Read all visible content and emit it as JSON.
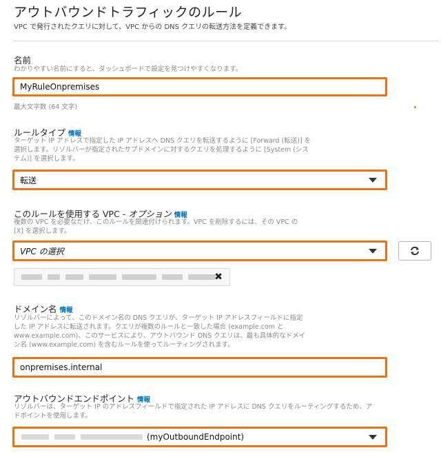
{
  "header": {
    "title": "アウトバウンドトラフィックのルール",
    "subtitle": "VPC で発行されたクエリに対して、VPC からの DNS クエリの転送方法を定義できます。"
  },
  "name_section": {
    "label": "名前",
    "help": "わかりやすい名前にすると、ダッシュボードで設定を見つけやすくなります。",
    "value": "MyRuleOnpremises",
    "limit": "最大文字数 (64 文字)"
  },
  "rule_type": {
    "label": "ルールタイプ",
    "info": "情報",
    "help_line1": "ターゲット IP アドレスで指定した IP アドレスへ DNS クエリを転送するように [Forward (転送)] を",
    "help_line2": "選択します。リゾルバーが指定されたサブドメインに対するクエリを処理するように [System (シス",
    "help_line3": "テム)] を選択します。",
    "value": "転送"
  },
  "vpc_section": {
    "label": "このルールを使用する VPC - ",
    "label_optional": "オプション",
    "info": "情報",
    "help_line1": "複数の VPC を必要なだけ、このルールを関連付けられます。VPC を削除するには、その VPC の",
    "help_line2": "[X] を選択します。",
    "placeholder": "VPC の選択",
    "remove_symbol": "✖"
  },
  "domain_section": {
    "label": "ドメイン名",
    "info": "情報",
    "help_line1": "リゾルバーによって、このドメイン名の DNS クエリが、ターゲット IP アドレスフィールドに指定",
    "help_line2": "した IP アドレスに転送されます。クエリが複数のルールと一致した場合 (example.com と",
    "help_line3": "www.example.com)、このサービスにより、アウトバウンド DNS クエリは、最も具体的なドメイ",
    "help_line4": "ン名 (www.example.com) を含むルールを使ってルーティングされます。",
    "value": "onpremises.internal"
  },
  "endpoint_section": {
    "label": "アウトバウンドエンドポイント",
    "info": "情報",
    "help_line1": "リゾルバーは、ターゲット IP のアドレスフィールドで指定された IP アドレスに DNS クエリをルーティングするため、ア",
    "help_line2": "ドポイントを使用します。",
    "value": "(myOutboundEndpoint)"
  },
  "icons": {
    "refresh": "refresh-icon",
    "dropdown": "chevron-down-icon",
    "remove": "close-icon"
  },
  "colors": {
    "highlight": "#ec7211",
    "info_link": "#0073bb"
  }
}
